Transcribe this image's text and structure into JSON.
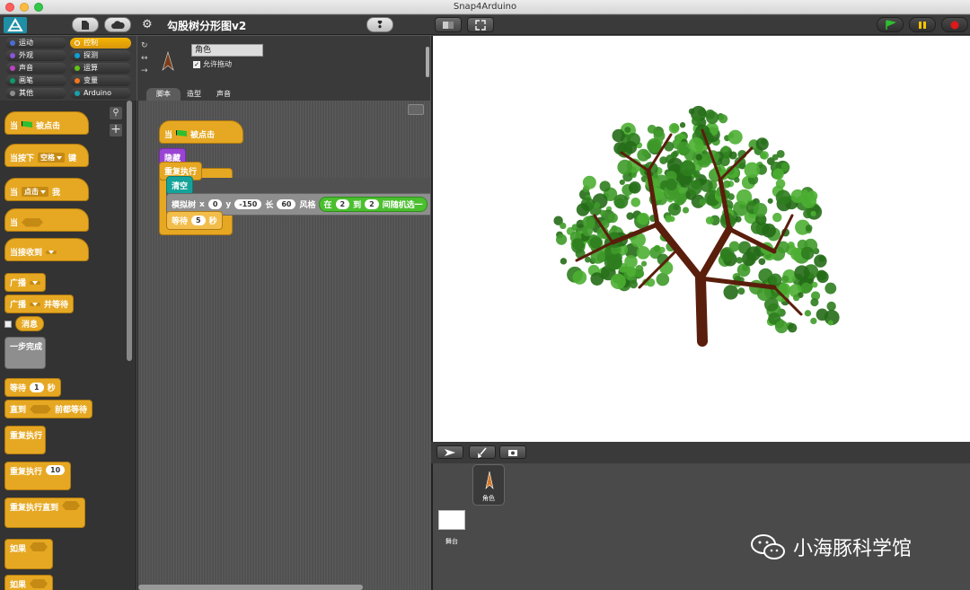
{
  "window": {
    "title": "Snap4Arduino"
  },
  "toolbar": {
    "project_name": "勾股树分形图v2"
  },
  "categories": [
    {
      "label": "运动",
      "color": "#4a6cd4"
    },
    {
      "label": "控制",
      "color": "#e6a822"
    },
    {
      "label": "外观",
      "color": "#8a55d7"
    },
    {
      "label": "探测",
      "color": "#0e9fd8"
    },
    {
      "label": "声音",
      "color": "#bb42c3"
    },
    {
      "label": "运算",
      "color": "#62c213"
    },
    {
      "label": "画笔",
      "color": "#0e9a6c"
    },
    {
      "label": "变量",
      "color": "#f3761d"
    },
    {
      "label": "其他",
      "color": "#8e8e8e"
    },
    {
      "label": "Arduino",
      "color": "#16a0aa"
    }
  ],
  "palette": {
    "when_flag": "当",
    "when_flag_suffix": "被点击",
    "when_key": "当按下",
    "when_key_val": "空格",
    "when_key_suffix": "键",
    "when_clicked": "当",
    "when_clicked_val": "点击",
    "when_clicked_suffix": "我",
    "when_cond": "当",
    "when_receive": "当接收到",
    "broadcast": "广播",
    "broadcast_wait": "广播",
    "broadcast_wait_suffix": "并等待",
    "message": "消息",
    "warp": "一步完成",
    "wait": "等待",
    "wait_val": "1",
    "wait_unit": "秒",
    "wait_until": "直到",
    "wait_until_suffix": "前都等待",
    "forever": "重复执行",
    "repeat": "重复执行",
    "repeat_val": "10",
    "repeat_until": "重复执行直到",
    "if1": "如果",
    "if2": "如果"
  },
  "sprite": {
    "name": "角色",
    "draggable_label": "允许拖动"
  },
  "tabs": [
    "脚本",
    "造型",
    "声音"
  ],
  "script": {
    "hat": "当",
    "hat_suffix": "被点击",
    "hide": "隐藏",
    "forever": "重复执行",
    "clear": "清空",
    "tree": "模拟树",
    "x_label": "x",
    "x_val": "0",
    "y_label": "y",
    "y_val": "-150",
    "len_label": "长",
    "len_val": "60",
    "style_label": "风格",
    "in_label": "在",
    "from_val": "2",
    "to_label": "到",
    "to_val": "2",
    "random_label": "间随机选一",
    "wait": "等待",
    "wait_val": "5",
    "wait_unit": "秒"
  },
  "corral": {
    "sprite_label": "角色",
    "stage_label": "舞台"
  },
  "watermark": "小海豚科学馆"
}
